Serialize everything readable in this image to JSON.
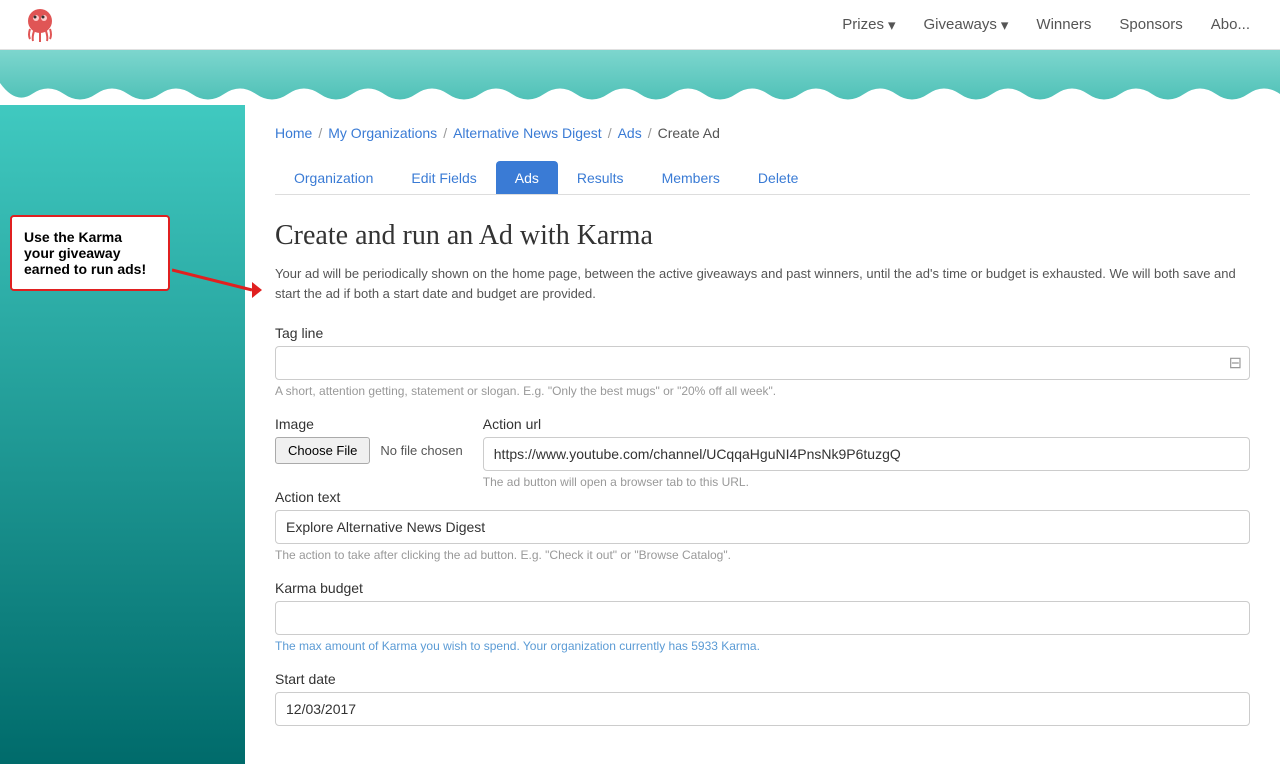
{
  "navbar": {
    "brand_alt": "Logo",
    "links": [
      {
        "label": "Prizes",
        "has_dropdown": true
      },
      {
        "label": "Giveaways",
        "has_dropdown": true
      },
      {
        "label": "Winners",
        "has_dropdown": false
      },
      {
        "label": "Sponsors",
        "has_dropdown": false
      },
      {
        "label": "Abo...",
        "has_dropdown": false
      }
    ]
  },
  "callout": {
    "text": "Use the Karma your giveaway earned to run ads!"
  },
  "breadcrumb": {
    "items": [
      "Home",
      "My Organizations",
      "Alternative News Digest",
      "Ads",
      "Create Ad"
    ],
    "separators": [
      "/",
      "/",
      "/",
      "/"
    ]
  },
  "tabs": [
    {
      "label": "Organization",
      "active": false
    },
    {
      "label": "Edit Fields",
      "active": false
    },
    {
      "label": "Ads",
      "active": true
    },
    {
      "label": "Results",
      "active": false
    },
    {
      "label": "Members",
      "active": false
    },
    {
      "label": "Delete",
      "active": false
    }
  ],
  "form": {
    "title": "Create and run an Ad with Karma",
    "description": "Your ad will be periodically shown on the home page, between the active giveaways and past winners, until the ad's time or budget is exhausted. We will both save and start the ad if both a start date and budget are provided.",
    "tag_line": {
      "label": "Tag line",
      "placeholder": "",
      "hint": "A short, attention getting, statement or slogan. E.g. \"Only the best mugs\" or \"20% off all week\"."
    },
    "image": {
      "label": "Image",
      "button_label": "Choose File",
      "file_name": "No file chosen"
    },
    "action_url": {
      "label": "Action url",
      "value": "https://www.youtube.com/channel/UCqqaHguNI4PnsNk9P6tuzgQ",
      "hint": "The ad button will open a browser tab to this URL."
    },
    "action_text": {
      "label": "Action text",
      "value": "Explore Alternative News Digest",
      "hint": "The action to take after clicking the ad button. E.g. \"Check it out\" or \"Browse Catalog\"."
    },
    "karma_budget": {
      "label": "Karma budget",
      "value": "",
      "hint": "The max amount of Karma you wish to spend. Your organization currently has 5933 Karma."
    },
    "start_date": {
      "label": "Start date",
      "value": "12/03/2017"
    }
  }
}
